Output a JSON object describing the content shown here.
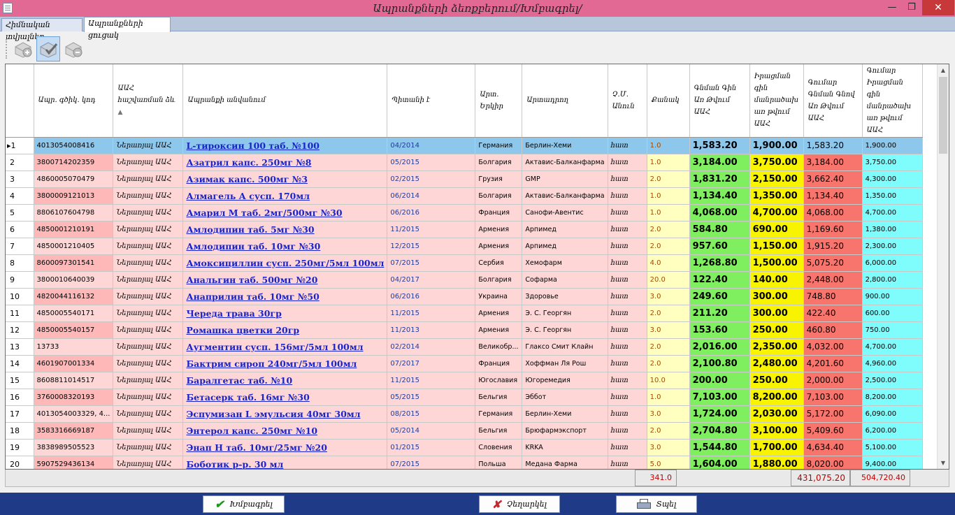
{
  "window": {
    "title": "Ապրանքների ձեռքբերում/Խմբագրել/",
    "min_glyph": "—",
    "max_glyph": "❐",
    "close_glyph": "✕"
  },
  "tabs": [
    {
      "label": "Հիմնական տվյալներ"
    },
    {
      "label": "Ապրանքների ցուցակ"
    }
  ],
  "toolbar": {
    "buttons": [
      {
        "icon": "add-icon"
      },
      {
        "icon": "edit-check-icon"
      },
      {
        "icon": "remove-icon"
      }
    ]
  },
  "grid": {
    "columns": [
      {
        "label": ""
      },
      {
        "label": "Ապր. գծիկ. կոդ"
      },
      {
        "label": "ԱԱՀ հաշվառման ձև"
      },
      {
        "label": "Ապրանքի անվանում"
      },
      {
        "label": "Պիտանի է"
      },
      {
        "label": "Արտ. Երկիր"
      },
      {
        "label": "Արտադրող"
      },
      {
        "label": "Չ.Մ. Անուն"
      },
      {
        "label": "Քանակ"
      },
      {
        "label": "Գնման Գին Առ Թվում ԱԱՀ"
      },
      {
        "label": "Իրացման գին մանրածախ առ թվում ԱԱՀ"
      },
      {
        "label": "Գումար Գնման Գնով Առ Թվում ԱԱՀ"
      },
      {
        "label": "Գումար Իրացման գին մանրածախ առ թվում ԱԱՀ"
      }
    ],
    "rows": [
      {
        "n": "1",
        "code": "4013054008416",
        "acc": "Ներառյալ ԱԱՀ",
        "name": "L-тироксин 100 таб. №100",
        "exp": "04/2014",
        "country": "Германия",
        "mfr": "Берлин-Хеми",
        "unit": "հատ",
        "qty": "1.0",
        "price": "1,583.20",
        "sale": "1,900.00",
        "tprice": "1,583.20",
        "tsale": "1,900.00"
      },
      {
        "n": "2",
        "code": "3800714202359",
        "acc": "Ներառյալ ԱԱՀ",
        "name": "Азатрил капс. 250мг №8",
        "exp": "05/2015",
        "country": "Болгария",
        "mfr": "Актавис-Балканфарма",
        "unit": "հատ",
        "qty": "1.0",
        "price": "3,184.00",
        "sale": "3,750.00",
        "tprice": "3,184.00",
        "tsale": "3,750.00"
      },
      {
        "n": "3",
        "code": "4860005070479",
        "acc": "Ներառյալ ԱԱՀ",
        "name": "Азимак капс. 500мг №3",
        "exp": "02/2015",
        "country": "Грузия",
        "mfr": "GMP",
        "unit": "հատ",
        "qty": "2.0",
        "price": "1,831.20",
        "sale": "2,150.00",
        "tprice": "3,662.40",
        "tsale": "4,300.00"
      },
      {
        "n": "4",
        "code": "3800009121013",
        "acc": "Ներառյալ ԱԱՀ",
        "name": "Алмагель А сусп. 170мл",
        "exp": "06/2014",
        "country": "Болгария",
        "mfr": "Актавис-Балканфарма",
        "unit": "հատ",
        "qty": "1.0",
        "price": "1,134.40",
        "sale": "1,350.00",
        "tprice": "1,134.40",
        "tsale": "1,350.00"
      },
      {
        "n": "5",
        "code": "8806107604798",
        "acc": "Ներառյալ ԱԱՀ",
        "name": "Амарил М таб. 2мг/500мг №30",
        "exp": "06/2016",
        "country": "Франция",
        "mfr": "Санофи-Авентис",
        "unit": "հատ",
        "qty": "1.0",
        "price": "4,068.00",
        "sale": "4,700.00",
        "tprice": "4,068.00",
        "tsale": "4,700.00"
      },
      {
        "n": "6",
        "code": "4850001210191",
        "acc": "Ներառյալ ԱԱՀ",
        "name": "Амлодипин таб. 5мг №30",
        "exp": "11/2015",
        "country": "Армения",
        "mfr": "Арпимед",
        "unit": "հատ",
        "qty": "2.0",
        "price": "584.80",
        "sale": "690.00",
        "tprice": "1,169.60",
        "tsale": "1,380.00"
      },
      {
        "n": "7",
        "code": "4850001210405",
        "acc": "Ներառյալ ԱԱՀ",
        "name": "Амлодипин таб. 10мг №30",
        "exp": "12/2015",
        "country": "Армения",
        "mfr": "Арпимед",
        "unit": "հատ",
        "qty": "2.0",
        "price": "957.60",
        "sale": "1,150.00",
        "tprice": "1,915.20",
        "tsale": "2,300.00"
      },
      {
        "n": "8",
        "code": "8600097301541",
        "acc": "Ներառյալ ԱԱՀ",
        "name": "Амоксициллин сусп. 250мг/5мл 100мл",
        "exp": "07/2015",
        "country": "Сербия",
        "mfr": "Хемофарм",
        "unit": "հատ",
        "qty": "4.0",
        "price": "1,268.80",
        "sale": "1,500.00",
        "tprice": "5,075.20",
        "tsale": "6,000.00"
      },
      {
        "n": "9",
        "code": "3800010640039",
        "acc": "Ներառյալ ԱԱՀ",
        "name": "Анальгин таб. 500мг №20",
        "exp": "04/2017",
        "country": "Болгария",
        "mfr": "Софарма",
        "unit": "հատ",
        "qty": "20.0",
        "price": "122.40",
        "sale": "140.00",
        "tprice": "2,448.00",
        "tsale": "2,800.00"
      },
      {
        "n": "10",
        "code": "4820044116132",
        "acc": "Ներառյալ ԱԱՀ",
        "name": "Анаприлин таб. 10мг №50",
        "exp": "06/2016",
        "country": "Украина",
        "mfr": "Здоровье",
        "unit": "հատ",
        "qty": "3.0",
        "price": "249.60",
        "sale": "300.00",
        "tprice": "748.80",
        "tsale": "900.00"
      },
      {
        "n": "11",
        "code": "4850005540171",
        "acc": "Ներառյալ ԱԱՀ",
        "name": "Череда трава 30гр",
        "exp": "11/2015",
        "country": "Армения",
        "mfr": "Э. С. Георгян",
        "unit": "հատ",
        "qty": "2.0",
        "price": "211.20",
        "sale": "300.00",
        "tprice": "422.40",
        "tsale": "600.00"
      },
      {
        "n": "12",
        "code": "4850005540157",
        "acc": "Ներառյալ ԱԱՀ",
        "name": "Ромашка цветки 20гр",
        "exp": "11/2013",
        "country": "Армения",
        "mfr": "Э. С. Георгян",
        "unit": "հատ",
        "qty": "3.0",
        "price": "153.60",
        "sale": "250.00",
        "tprice": "460.80",
        "tsale": "750.00"
      },
      {
        "n": "13",
        "code": "13733",
        "acc": "Ներառյալ ԱԱՀ",
        "name": "Аугментин сусп. 156мг/5мл 100мл",
        "exp": "02/2014",
        "country": "Великобр...",
        "mfr": "Глаксо Смит Клайн",
        "unit": "հատ",
        "qty": "2.0",
        "price": "2,016.00",
        "sale": "2,350.00",
        "tprice": "4,032.00",
        "tsale": "4,700.00"
      },
      {
        "n": "14",
        "code": "4601907001334",
        "acc": "Ներառյալ ԱԱՀ",
        "name": "Бактрим сироп 240мг/5мл 100мл",
        "exp": "07/2017",
        "country": "Франция",
        "mfr": "Хоффман Ля Рош",
        "unit": "հատ",
        "qty": "2.0",
        "price": "2,100.80",
        "sale": "2,480.00",
        "tprice": "4,201.60",
        "tsale": "4,960.00"
      },
      {
        "n": "15",
        "code": "8608811014517",
        "acc": "Ներառյալ ԱԱՀ",
        "name": "Баралгетас таб. №10",
        "exp": "11/2015",
        "country": "Югославия",
        "mfr": "Югоремедия",
        "unit": "հատ",
        "qty": "10.0",
        "price": "200.00",
        "sale": "250.00",
        "tprice": "2,000.00",
        "tsale": "2,500.00"
      },
      {
        "n": "16",
        "code": "3760008320193",
        "acc": "Ներառյալ ԱԱՀ",
        "name": "Бетасерк таб. 16мг №30",
        "exp": "05/2015",
        "country": "Бельгия",
        "mfr": "Эббот",
        "unit": "հատ",
        "qty": "1.0",
        "price": "7,103.00",
        "sale": "8,200.00",
        "tprice": "7,103.00",
        "tsale": "8,200.00"
      },
      {
        "n": "17",
        "code": "4013054003329, 4...",
        "acc": "Ներառյալ ԱԱՀ",
        "name": "Эспумизан L эмульсия 40мг 30мл",
        "exp": "08/2015",
        "country": "Германия",
        "mfr": "Берлин-Хеми",
        "unit": "հատ",
        "qty": "3.0",
        "price": "1,724.00",
        "sale": "2,030.00",
        "tprice": "5,172.00",
        "tsale": "6,090.00"
      },
      {
        "n": "18",
        "code": "3583316669187",
        "acc": "Ներառյալ ԱԱՀ",
        "name": "Энтерол капс. 250мг №10",
        "exp": "05/2014",
        "country": "Бельгия",
        "mfr": "Брюфармэкспорт",
        "unit": "հատ",
        "qty": "2.0",
        "price": "2,704.80",
        "sale": "3,100.00",
        "tprice": "5,409.60",
        "tsale": "6,200.00"
      },
      {
        "n": "19",
        "code": "3838989505523",
        "acc": "Ներառյալ ԱԱՀ",
        "name": "Энап Н таб. 10мг/25мг №20",
        "exp": "01/2015",
        "country": "Словения",
        "mfr": "KRKA",
        "unit": "հատ",
        "qty": "3.0",
        "price": "1,544.80",
        "sale": "1,700.00",
        "tprice": "4,634.40",
        "tsale": "5,100.00"
      },
      {
        "n": "20",
        "code": "5907529436134",
        "acc": "Ներառյալ ԱԱՀ",
        "name": "Боботик р-р. 30 мл",
        "exp": "07/2015",
        "country": "Польша",
        "mfr": "Медана Фарма",
        "unit": "հատ",
        "qty": "5.0",
        "price": "1,604.00",
        "sale": "1,880.00",
        "tprice": "8,020.00",
        "tsale": "9,400.00"
      }
    ],
    "totals": {
      "qty": "341.0",
      "purchase_sum": "431,075.20",
      "sale_sum": "504,720.40"
    }
  },
  "footer": {
    "edit_label": "Խմբագրել",
    "cancel_label": "Չեղարկել",
    "print_label": "Տպել"
  },
  "colors": {
    "titlebar": "#e26994",
    "bottombar": "#1f3a86",
    "row_bg": "#ffd6d6",
    "qty_bg": "#ffffbf",
    "price_bg": "#7fef5f",
    "sale_bg": "#f8f400",
    "total_price_bg": "#f7756c",
    "total_sale_bg": "#7ffcfc",
    "selected_row": "#8dc7ec"
  }
}
